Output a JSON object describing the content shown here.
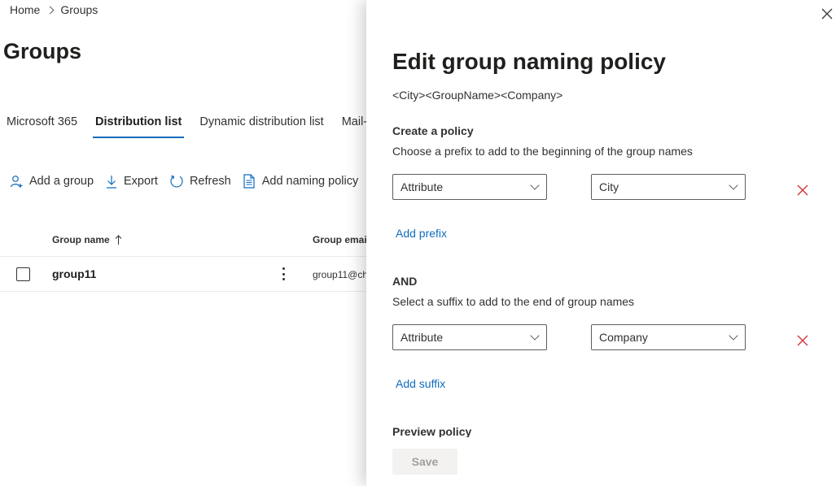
{
  "breadcrumb": {
    "home": "Home",
    "current": "Groups"
  },
  "page": {
    "title": "Groups"
  },
  "tabs": [
    {
      "label": "Microsoft 365",
      "active": false
    },
    {
      "label": "Distribution list",
      "active": true
    },
    {
      "label": "Dynamic distribution list",
      "active": false
    },
    {
      "label": "Mail-e",
      "active": false
    }
  ],
  "toolbar": {
    "add_group": "Add a group",
    "export": "Export",
    "refresh": "Refresh",
    "add_naming_policy": "Add naming policy"
  },
  "table": {
    "columns": {
      "name": "Group name",
      "email": "Group email"
    },
    "rows": [
      {
        "name": "group11",
        "email": "group11@ch"
      }
    ]
  },
  "panel": {
    "title": "Edit group naming policy",
    "format_preview": "<City><GroupName><Company>",
    "create_label": "Create a policy",
    "prefix_desc": "Choose a prefix to add to the beginning of the group names",
    "prefix": {
      "type": "Attribute",
      "value": "City"
    },
    "add_prefix": "Add prefix",
    "and_label": "AND",
    "suffix_desc": "Select a suffix to add to the end of group names",
    "suffix": {
      "type": "Attribute",
      "value": "Company"
    },
    "add_suffix": "Add suffix",
    "preview_label": "Preview policy",
    "save": "Save"
  },
  "colors": {
    "accent": "#0f6cbd",
    "danger": "#d13438"
  }
}
